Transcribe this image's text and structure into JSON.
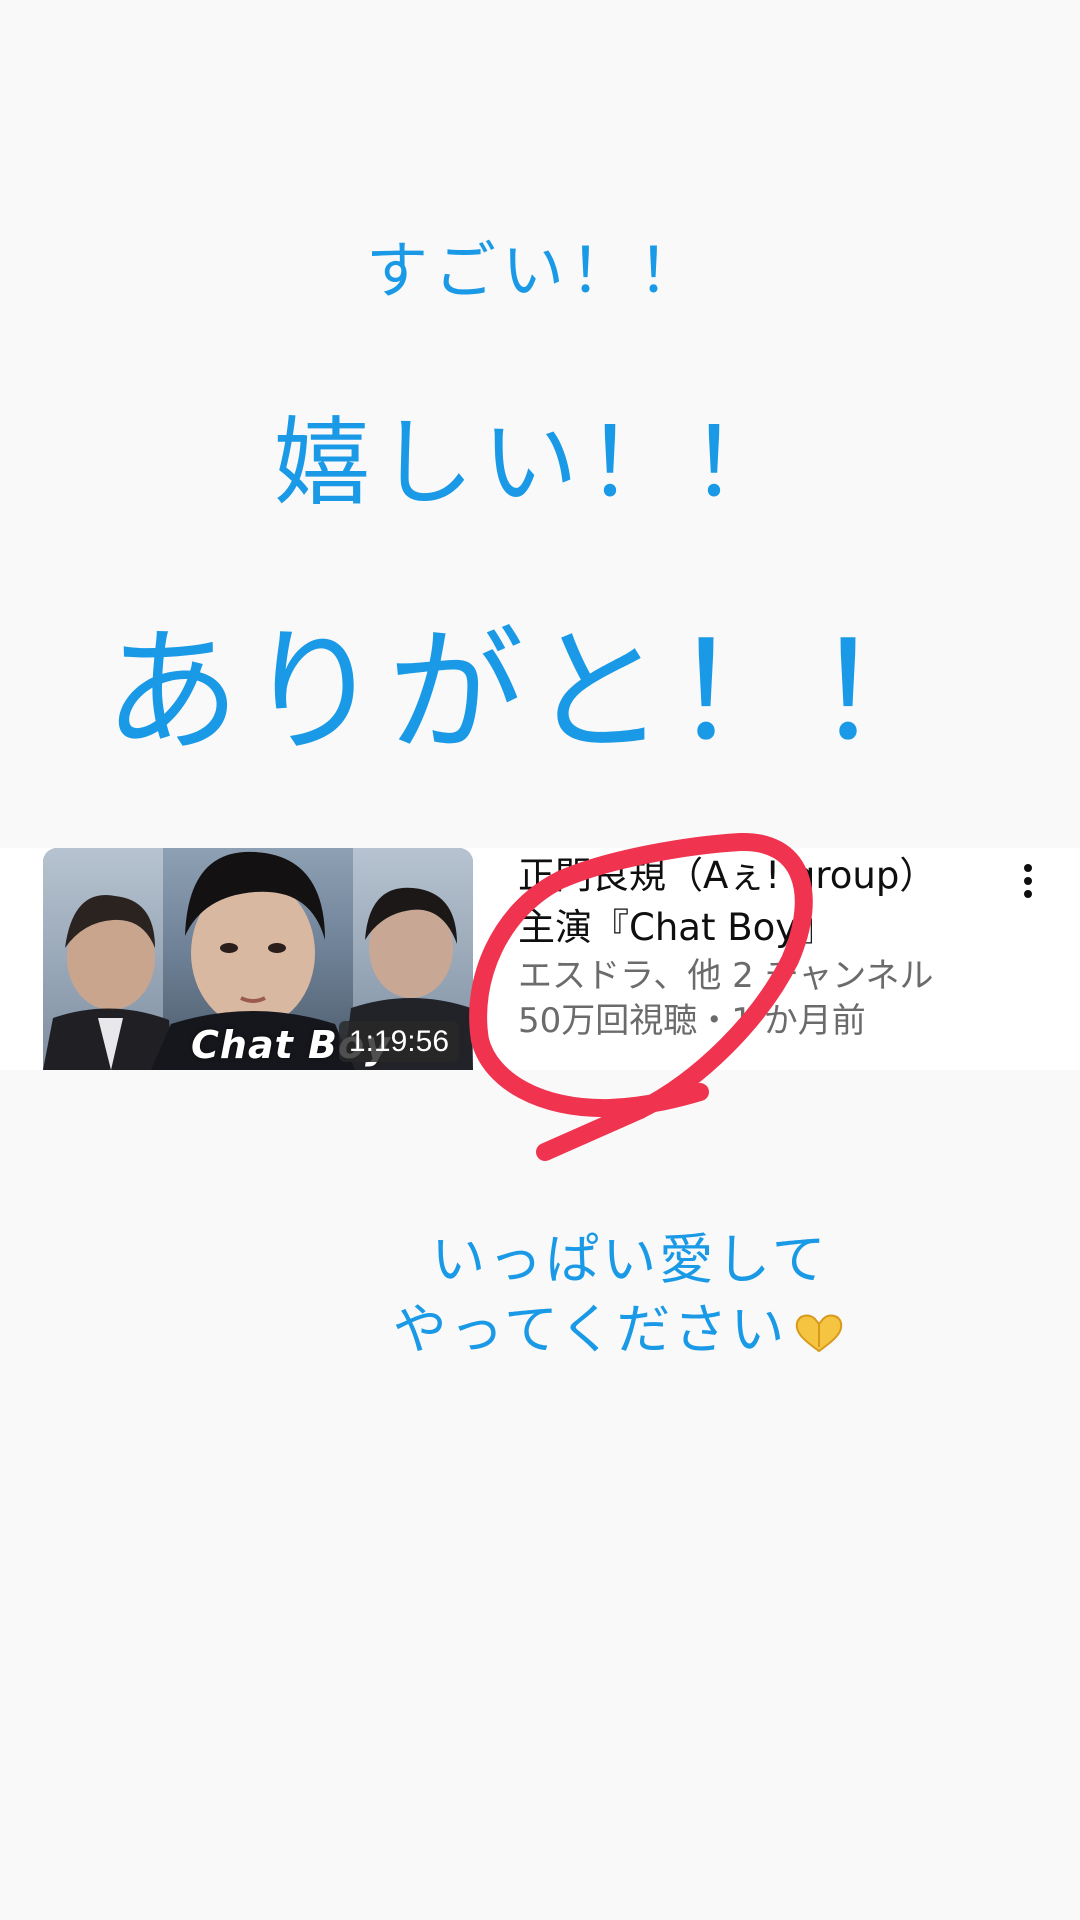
{
  "story_captions": {
    "line1": "すごい！！",
    "line2": "嬉しい！！",
    "line3": "ありがと！！"
  },
  "video_card": {
    "title_line1": "正門良規（Aぇ! group）",
    "title_line2": "主演『Chat Boy』",
    "channel": "エスドラ、他 2 チャンネル",
    "stats": "50万回視聴・1 か月前",
    "duration": "1:19:56",
    "thumbnail_text": "Chat Boy",
    "menu_icon": "more-vert-icon"
  },
  "closing_caption": {
    "line1": "いっぱい愛して",
    "line2": "やってください",
    "emoji": "heart-hands-icon"
  },
  "colors": {
    "caption_blue": "#1a9ae6",
    "annotation_red": "#f0334f",
    "background": "#f9f9f9"
  }
}
